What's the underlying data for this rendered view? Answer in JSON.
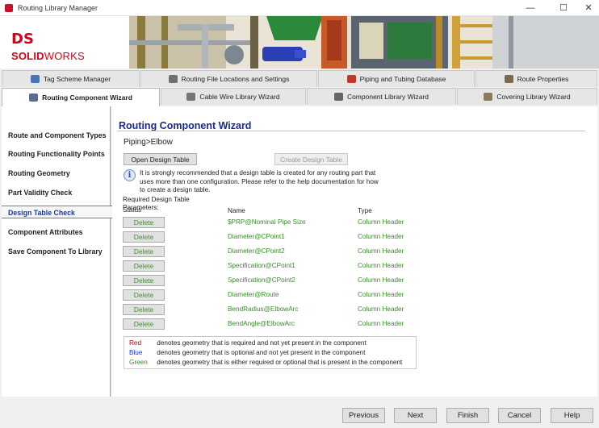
{
  "window": {
    "title": "Routing Library Manager",
    "minimize_glyph": "—",
    "maximize_glyph": "☐",
    "close_glyph": "✕"
  },
  "banner": {
    "logo_mark": "DS",
    "logo_solid": "SOLID",
    "logo_works": "WORKS"
  },
  "tabs_row1": [
    {
      "label": "Tag Scheme Manager",
      "icon": "tag-icon",
      "color": "#4a74b8"
    },
    {
      "label": "Routing File Locations and Settings",
      "icon": "folder-settings-icon",
      "color": "#6f6f6f"
    },
    {
      "label": "Piping and Tubing Database",
      "icon": "database-icon",
      "color": "#c0392b"
    },
    {
      "label": "Route Properties",
      "icon": "properties-icon",
      "color": "#7a6a4a"
    }
  ],
  "tabs_row2": [
    {
      "label": "Routing Component Wizard",
      "icon": "wizard-icon",
      "color": "#5a6e8a",
      "active": true
    },
    {
      "label": "Cable Wire Library Wizard",
      "icon": "cable-icon",
      "color": "#777777"
    },
    {
      "label": "Component Library Wizard",
      "icon": "component-icon",
      "color": "#666666"
    },
    {
      "label": "Covering Library Wizard",
      "icon": "covering-icon",
      "color": "#8a7a5a"
    }
  ],
  "sidebar": {
    "items": [
      {
        "label": "Route and Component Types"
      },
      {
        "label": "Routing Functionality Points"
      },
      {
        "label": "Routing Geometry"
      },
      {
        "label": "Part Validity Check"
      },
      {
        "label": "Design Table Check",
        "active": true
      },
      {
        "label": "Component Attributes"
      },
      {
        "label": "Save Component To Library"
      }
    ]
  },
  "main": {
    "heading": "Routing Component Wizard",
    "breadcrumb": "Piping>Elbow",
    "open_design_table": "Open Design Table",
    "create_design_table": "Create Design Table",
    "info_icon_glyph": "i",
    "info_text": "It is strongly recommended that a design table is created for any routing part that uses more than one configuration.  Please refer to the help documentation for how to create a design table.",
    "required_label": "Required Design Table Parameters:",
    "columns": {
      "status": "Status",
      "name": "Name",
      "type": "Type"
    },
    "rows": [
      {
        "action": "Delete",
        "name": "$PRP@Nominal Pipe Size",
        "type": "Column Header"
      },
      {
        "action": "Delete",
        "name": "Diameter@CPoint1",
        "type": "Column Header"
      },
      {
        "action": "Delete",
        "name": "Diameter@CPoint2",
        "type": "Column Header"
      },
      {
        "action": "Delete",
        "name": "Specification@CPoint1",
        "type": "Column Header"
      },
      {
        "action": "Delete",
        "name": "Specification@CPoint2",
        "type": "Column Header"
      },
      {
        "action": "Delete",
        "name": "Diameter@Route",
        "type": "Column Header"
      },
      {
        "action": "Delete",
        "name": "BendRadius@ElbowArc",
        "type": "Column Header"
      },
      {
        "action": "Delete",
        "name": "BendAngle@ElbowArc",
        "type": "Column Header"
      }
    ],
    "legend": [
      {
        "color_name": "Red",
        "text": "denotes geometry that is required and not yet present in the component"
      },
      {
        "color_name": "Blue",
        "text": "denotes geometry that is optional and not yet present in the component"
      },
      {
        "color_name": "Green",
        "text": "denotes geometry that is either required or optional that is present in the component"
      }
    ]
  },
  "footer": {
    "previous": "Previous",
    "next": "Next",
    "finish": "Finish",
    "cancel": "Cancel",
    "help": "Help"
  },
  "colors": {
    "heading": "#1a2a90",
    "present_green": "#3a8a2a",
    "brand_red": "#d0021b"
  }
}
